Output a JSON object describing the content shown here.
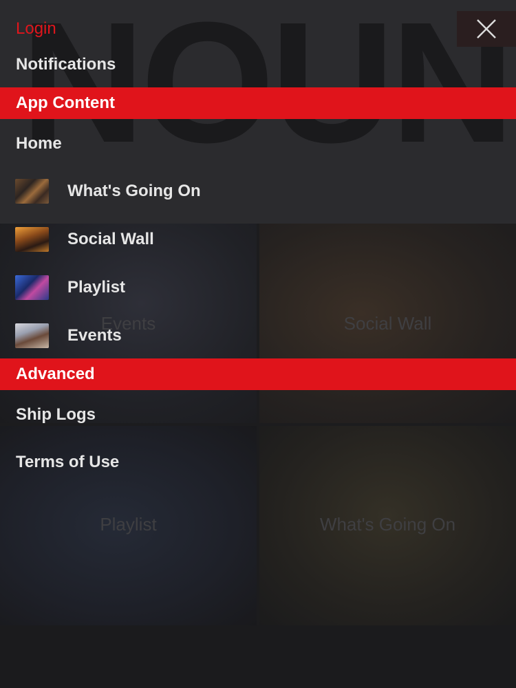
{
  "background": {
    "logo_text": "NOUN",
    "tiles": {
      "events": "Events",
      "social_wall": "Social Wall",
      "playlist": "Playlist",
      "whats_going_on": "What's Going On"
    }
  },
  "close_icon": "close-icon",
  "menu": {
    "login": "Login",
    "notifications": "Notifications",
    "section_app_content": "App Content",
    "home": "Home",
    "items": [
      {
        "label": "What's Going On",
        "thumb": "whats-going-on-thumbnail"
      },
      {
        "label": "Social Wall",
        "thumb": "social-wall-thumbnail"
      },
      {
        "label": "Playlist",
        "thumb": "playlist-thumbnail"
      },
      {
        "label": "Events",
        "thumb": "events-thumbnail"
      }
    ],
    "section_advanced": "Advanced",
    "ship_logs": "Ship Logs",
    "terms_of_use": "Terms of Use"
  },
  "colors": {
    "accent": "#e0141b",
    "menu_text": "#e6e6e6",
    "overlay_bg": "#1c1c1e"
  }
}
